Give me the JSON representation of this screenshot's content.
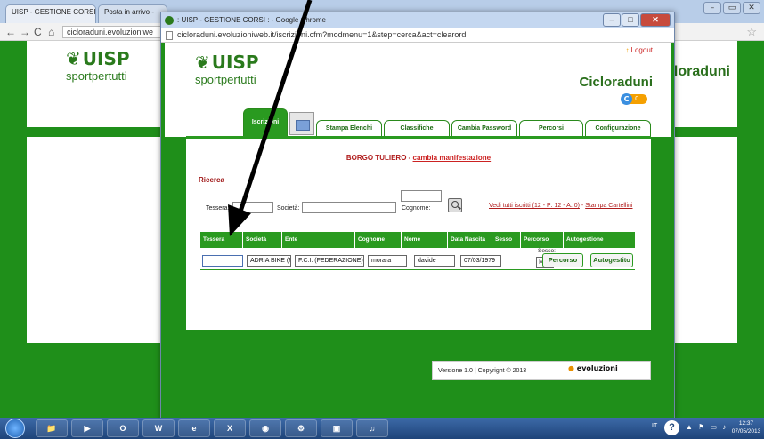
{
  "background_browser": {
    "tab1_title": "UISP - GESTIONE CORSI",
    "tab2_title": "Posta in arrivo -",
    "url": "cicloraduni.evoluzioniwe",
    "win_minimize": "–",
    "win_restore": "▭",
    "win_close": "✕",
    "logo_text": "UISP",
    "logo_sub": "sportpertutti",
    "site_title": "Cicloraduni",
    "footer_logo": "evoluzioni"
  },
  "window": {
    "title": ": UISP - GESTIONE CORSI : - Google Chrome",
    "url": "cicloraduni.evoluzioniweb.it/iscrizioni.cfm?modmenu=1&step=cerca&act=clearord",
    "min_btn": "–",
    "max_btn": "□",
    "close_btn": "✕"
  },
  "header": {
    "logo_text": "UISP",
    "logo_sub": "sportpertutti",
    "logout_label": "Logout",
    "site_title": "Cicloraduni",
    "badge_letter": "C",
    "badge_count": "0"
  },
  "tabs": [
    "Iscrizioni",
    "Stampa Elenchi",
    "Classifiche",
    "Cambia Password",
    "Percorsi",
    "Configurazione"
  ],
  "event": {
    "name": "BORGO TULIERO",
    "separator": " - ",
    "change_link": "cambia manifestazione"
  },
  "search": {
    "heading": "Ricerca",
    "tessera_label": "Tessera:",
    "societa_label": "Società:",
    "cognome_label": "Cognome:",
    "vedi_link": "Vedi tutti iscritti (12 - P: 12 - A: 0)",
    "sep": " - ",
    "stampa_link": "Stampa Cartellini"
  },
  "table": {
    "columns": [
      "Tessera",
      "Società",
      "Ente",
      "Cognome",
      "Nome",
      "Data Nascita",
      "Sesso",
      "Percorso",
      "Autogestione"
    ],
    "row": {
      "tessera": "",
      "societa": "ADRIA BIKE (PR",
      "ente": "F.C.I. (FEDERAZIONE)",
      "cognome": "morara",
      "nome": "davide",
      "data_nascita": "07/03/1979",
      "sesso_label": "Sesso:",
      "sesso_value": "M",
      "percorso_btn": "Percorso",
      "autogestito_btn": "Autogestito"
    }
  },
  "footer": {
    "version": "Versione 1.0 | Copyright © 2013",
    "logo": "evoluzioni"
  },
  "taskbar": {
    "items": [
      "📁",
      "▶",
      "O",
      "W",
      "e",
      "X",
      "◉",
      "⚙",
      "▣",
      "♫"
    ],
    "lang": "IT",
    "help": "?",
    "tray_icons": "▲ ⚑ ▭ ♪",
    "time": "12:37",
    "date": "07/05/2013"
  },
  "colors": {
    "site_green": "#1f8f1a",
    "tab_green": "#2a9a20",
    "event_red": "#b01c1c",
    "brand_orange": "#f5a000"
  }
}
